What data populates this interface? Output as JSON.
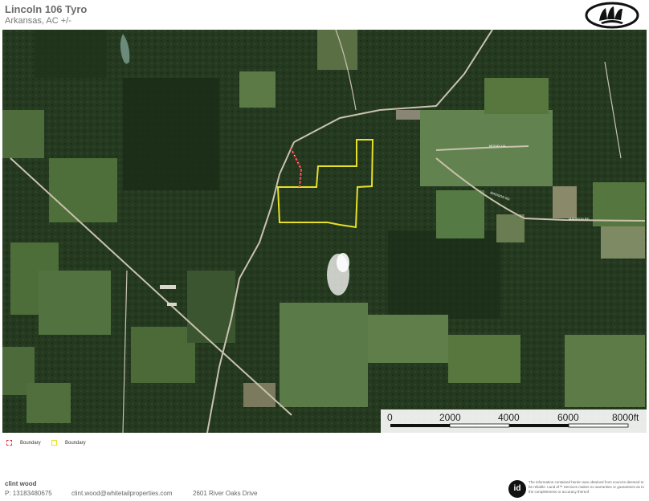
{
  "header": {
    "title": "Lincoln 106 Tyro",
    "subtitle": "Arkansas,  AC +/-"
  },
  "logo": {
    "icon": "paw-print-logo-icon"
  },
  "map": {
    "type": "satellite",
    "labels": {
      "road_a": "MCKAY LN",
      "road_b": "MADISON RD",
      "road_c": "MADISON RD"
    },
    "colors": {
      "boundary_red": "#e8303a",
      "boundary_yellow": "#e6e02a",
      "road": "#c9c2ae"
    }
  },
  "scale": {
    "ticks": [
      "0",
      "2000",
      "4000",
      "6000",
      "8000ft"
    ]
  },
  "legend": {
    "items": [
      {
        "label": "Boundary",
        "color": "#e8303a"
      },
      {
        "label": "Boundary",
        "color": "#e6e02a"
      }
    ]
  },
  "footer": {
    "name": "clint wood",
    "phone": "P: 13183480675",
    "email": "clint.wood@whitetailproperties.com",
    "address": "2601 River Oaks Drive",
    "badge": "id",
    "disclaimer": "The information contained herein was obtained from sources deemed to be reliable. Land id™ Services makes no warranties or guarantees as to the completeness or accuracy thereof."
  }
}
